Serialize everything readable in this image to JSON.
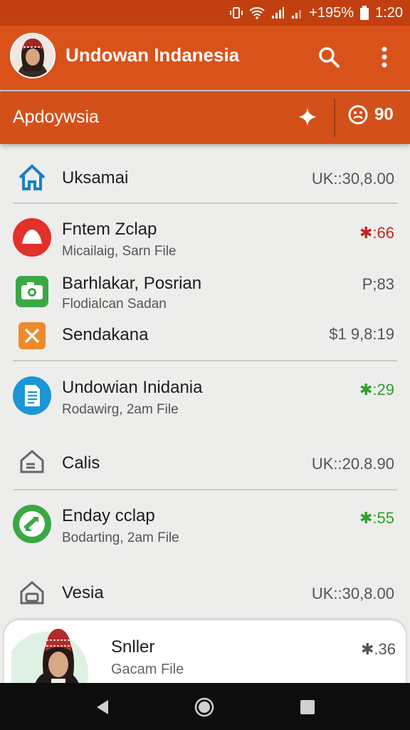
{
  "status_bar": {
    "battery": "+195%",
    "time": "1:20"
  },
  "app_bar": {
    "title": "Undowan Indanesia"
  },
  "sub_bar": {
    "title": "Apdoywsia",
    "count": "90"
  },
  "rows": [
    {
      "title": "Uksamai",
      "amount": "UK::30,8.00",
      "icon": "home-icon",
      "color": "#1a7fc7"
    },
    {
      "title": "Fntem Zclap",
      "subtitle": "Micailaig, Sarn File",
      "amount": "✱:66",
      "icon": "red-circle-icon",
      "color": "#e2312a"
    },
    {
      "title": "Barhlakar, Posrian",
      "subtitle": "Flodialcan Sadan",
      "amount": "P;83",
      "icon": "camera-icon",
      "color": "#3aa844"
    },
    {
      "title": "Sendakana",
      "amount": "$1 9,8:19",
      "icon": "close-square-icon",
      "color": "#ee8a2a"
    },
    {
      "title": "Undowian Inidania",
      "subtitle": "Rodawirg, 2am File",
      "amount": "✱:29",
      "icon": "document-icon",
      "color": "#1c96d6"
    },
    {
      "title": "Calis",
      "amount": "UK::20.8.90",
      "icon": "house-outline-icon",
      "color": "#666"
    },
    {
      "title": "Enday cclap",
      "subtitle": "Bodarting, 2am File",
      "amount": "✱:55",
      "icon": "sync-icon",
      "color": "#3aa844"
    },
    {
      "title": "Vesia",
      "amount": "UK::30,8.00",
      "icon": "house-wallet-icon",
      "color": "#666"
    }
  ],
  "card": {
    "title": "Snller",
    "subtitle": "Gacam File",
    "amount": "✱.36"
  }
}
